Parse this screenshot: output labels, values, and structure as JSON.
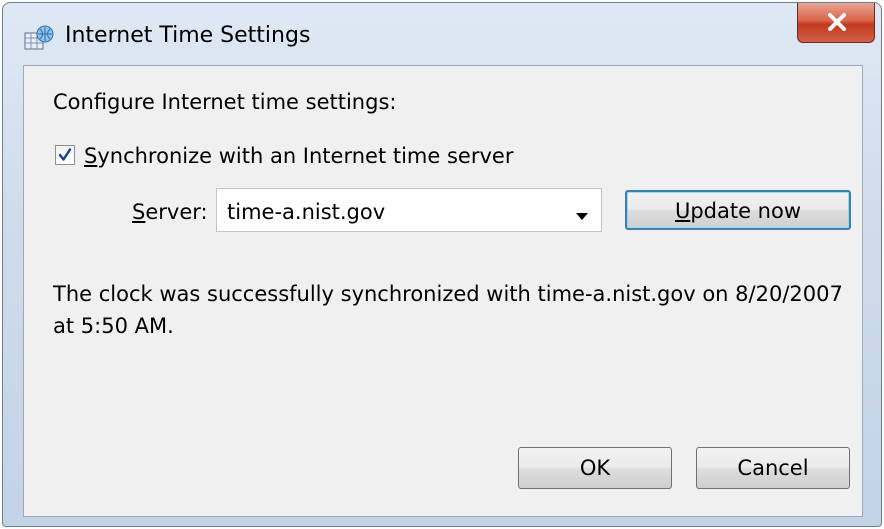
{
  "window": {
    "title": "Internet Time Settings",
    "title_icon": "clock-globe-icon",
    "close_icon": "close-icon"
  },
  "main": {
    "configure_label": "Configure Internet time settings:",
    "sync_checkbox": {
      "checked": true,
      "label_first": "S",
      "label_rest": "ynchronize with an Internet time server"
    },
    "server": {
      "label_first": "S",
      "label_rest": "erver:",
      "value": "time-a.nist.gov",
      "dropdown_icon": "chevron-down-icon"
    },
    "update_button": {
      "label_first": "U",
      "label_rest": "pdate now"
    },
    "status_line1": "The clock was successfully synchronized with time-a.nist.gov on 8/20/2007",
    "status_line2": "at 5:50 AM."
  },
  "footer": {
    "ok_label": "OK",
    "cancel_label": "Cancel"
  },
  "colors": {
    "close_button": "#c1391f",
    "default_button_border": "#3c7fb1",
    "dialog_face": "#f0f0f0"
  }
}
